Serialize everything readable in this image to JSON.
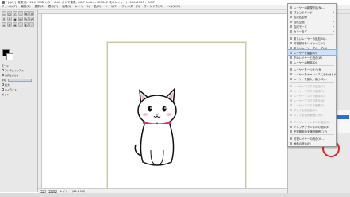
{
  "window": {
    "title": "*[ねこ] (変更済) -13.0 (RGB カラー 8-bit ガンマ整数, GIMP built-in sRGB, 2 枚のレイヤー) 1000x1000 – GIMP"
  },
  "menubar": {
    "items": [
      "ファイル(F)",
      "編集(E)",
      "選択(S)",
      "表示(V)",
      "画像(I)",
      "レイヤー(L)",
      "色(C)",
      "ツール(T)",
      "フィルター(R)",
      "ウィンドウ(W)",
      "ヘルプ(H)"
    ]
  },
  "toolbox": {
    "options": [
      "モード",
      "アンチエイリアス",
      "境界をぼかす",
      "半径",
      "拡大",
      "ハイライト",
      "ガイド"
    ]
  },
  "statusbar": {
    "unit": "px",
    "zoom": "100%",
    "text": "レイヤー（63.1 MB）"
  },
  "context_menu": {
    "items": [
      {
        "label": "レイヤーの新規作成(N)...",
        "state": "normal"
      },
      {
        "label": "ブレンドモード",
        "state": "normal",
        "submenu": true
      },
      {
        "label": "合成色空間",
        "state": "normal",
        "submenu": true
      },
      {
        "label": "合成空間",
        "state": "normal",
        "submenu": true
      },
      {
        "label": "合成モード",
        "state": "normal",
        "submenu": true
      },
      {
        "label": "カラータグ",
        "state": "normal",
        "submenu": true
      },
      {
        "sep": true
      },
      {
        "label": "新しいレイヤーの追加(N)...",
        "state": "normal"
      },
      {
        "label": "可視部分をレイヤーに(V)",
        "state": "normal"
      },
      {
        "label": "新しいレイヤーグループ(G)",
        "state": "normal"
      },
      {
        "label": "レイヤーを複製(U)",
        "state": "highlighted"
      },
      {
        "label": "下のレイヤーと統合(W)",
        "state": "normal"
      },
      {
        "label": "レイヤーの削除(D)",
        "state": "normal"
      },
      {
        "sep": true
      },
      {
        "label": "レイヤーを一つ上へ(R)",
        "state": "normal"
      },
      {
        "label": "レイヤーをキャンバスに合わせる(C)",
        "state": "normal"
      },
      {
        "label": "レイヤーを拡大・縮小(S)...",
        "state": "normal"
      },
      {
        "sep": true
      },
      {
        "label": "レイヤーマスクの追加(A)...",
        "state": "disabled"
      },
      {
        "label": "レイヤーマスクの適用(Y)",
        "state": "disabled"
      },
      {
        "label": "レイヤーマスクの削除(K)",
        "state": "disabled"
      },
      {
        "label": "レイヤーマスクの表示(W)",
        "state": "disabled"
      },
      {
        "label": "レイヤーマスクの編集(E)",
        "state": "disabled"
      },
      {
        "label": "マスクを無効化(D)",
        "state": "disabled"
      },
      {
        "label": "マスクを選択範囲に(M)",
        "state": "disabled"
      },
      {
        "sep": true
      },
      {
        "label": "アルファチャンネルの追加(H)",
        "state": "disabled"
      },
      {
        "label": "アルファチャンネルの削除(E)",
        "state": "normal"
      },
      {
        "label": "不透明部分を選択範囲に(P)",
        "state": "normal"
      },
      {
        "sep": true
      },
      {
        "label": "可視レイヤーの統合(V)...",
        "state": "normal"
      },
      {
        "label": "画像の統合(F)",
        "state": "normal"
      }
    ]
  },
  "colors": {
    "highlight": "#cde2fb",
    "annotation": "#e2231a",
    "layer_selected": "#2a6fd6",
    "canvas_border": "#c9c99a"
  },
  "icons": {
    "app": "gimp-icon",
    "tools": "tool-icon"
  }
}
